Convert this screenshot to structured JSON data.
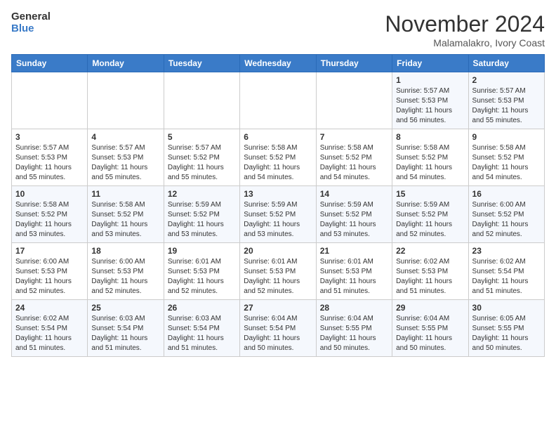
{
  "logo": {
    "line1": "General",
    "line2": "Blue"
  },
  "title": "November 2024",
  "location": "Malamalakro, Ivory Coast",
  "weekdays": [
    "Sunday",
    "Monday",
    "Tuesday",
    "Wednesday",
    "Thursday",
    "Friday",
    "Saturday"
  ],
  "weeks": [
    [
      {
        "day": "",
        "info": ""
      },
      {
        "day": "",
        "info": ""
      },
      {
        "day": "",
        "info": ""
      },
      {
        "day": "",
        "info": ""
      },
      {
        "day": "",
        "info": ""
      },
      {
        "day": "1",
        "info": "Sunrise: 5:57 AM\nSunset: 5:53 PM\nDaylight: 11 hours\nand 56 minutes."
      },
      {
        "day": "2",
        "info": "Sunrise: 5:57 AM\nSunset: 5:53 PM\nDaylight: 11 hours\nand 55 minutes."
      }
    ],
    [
      {
        "day": "3",
        "info": "Sunrise: 5:57 AM\nSunset: 5:53 PM\nDaylight: 11 hours\nand 55 minutes."
      },
      {
        "day": "4",
        "info": "Sunrise: 5:57 AM\nSunset: 5:53 PM\nDaylight: 11 hours\nand 55 minutes."
      },
      {
        "day": "5",
        "info": "Sunrise: 5:57 AM\nSunset: 5:52 PM\nDaylight: 11 hours\nand 55 minutes."
      },
      {
        "day": "6",
        "info": "Sunrise: 5:58 AM\nSunset: 5:52 PM\nDaylight: 11 hours\nand 54 minutes."
      },
      {
        "day": "7",
        "info": "Sunrise: 5:58 AM\nSunset: 5:52 PM\nDaylight: 11 hours\nand 54 minutes."
      },
      {
        "day": "8",
        "info": "Sunrise: 5:58 AM\nSunset: 5:52 PM\nDaylight: 11 hours\nand 54 minutes."
      },
      {
        "day": "9",
        "info": "Sunrise: 5:58 AM\nSunset: 5:52 PM\nDaylight: 11 hours\nand 54 minutes."
      }
    ],
    [
      {
        "day": "10",
        "info": "Sunrise: 5:58 AM\nSunset: 5:52 PM\nDaylight: 11 hours\nand 53 minutes."
      },
      {
        "day": "11",
        "info": "Sunrise: 5:58 AM\nSunset: 5:52 PM\nDaylight: 11 hours\nand 53 minutes."
      },
      {
        "day": "12",
        "info": "Sunrise: 5:59 AM\nSunset: 5:52 PM\nDaylight: 11 hours\nand 53 minutes."
      },
      {
        "day": "13",
        "info": "Sunrise: 5:59 AM\nSunset: 5:52 PM\nDaylight: 11 hours\nand 53 minutes."
      },
      {
        "day": "14",
        "info": "Sunrise: 5:59 AM\nSunset: 5:52 PM\nDaylight: 11 hours\nand 53 minutes."
      },
      {
        "day": "15",
        "info": "Sunrise: 5:59 AM\nSunset: 5:52 PM\nDaylight: 11 hours\nand 52 minutes."
      },
      {
        "day": "16",
        "info": "Sunrise: 6:00 AM\nSunset: 5:52 PM\nDaylight: 11 hours\nand 52 minutes."
      }
    ],
    [
      {
        "day": "17",
        "info": "Sunrise: 6:00 AM\nSunset: 5:53 PM\nDaylight: 11 hours\nand 52 minutes."
      },
      {
        "day": "18",
        "info": "Sunrise: 6:00 AM\nSunset: 5:53 PM\nDaylight: 11 hours\nand 52 minutes."
      },
      {
        "day": "19",
        "info": "Sunrise: 6:01 AM\nSunset: 5:53 PM\nDaylight: 11 hours\nand 52 minutes."
      },
      {
        "day": "20",
        "info": "Sunrise: 6:01 AM\nSunset: 5:53 PM\nDaylight: 11 hours\nand 52 minutes."
      },
      {
        "day": "21",
        "info": "Sunrise: 6:01 AM\nSunset: 5:53 PM\nDaylight: 11 hours\nand 51 minutes."
      },
      {
        "day": "22",
        "info": "Sunrise: 6:02 AM\nSunset: 5:53 PM\nDaylight: 11 hours\nand 51 minutes."
      },
      {
        "day": "23",
        "info": "Sunrise: 6:02 AM\nSunset: 5:54 PM\nDaylight: 11 hours\nand 51 minutes."
      }
    ],
    [
      {
        "day": "24",
        "info": "Sunrise: 6:02 AM\nSunset: 5:54 PM\nDaylight: 11 hours\nand 51 minutes."
      },
      {
        "day": "25",
        "info": "Sunrise: 6:03 AM\nSunset: 5:54 PM\nDaylight: 11 hours\nand 51 minutes."
      },
      {
        "day": "26",
        "info": "Sunrise: 6:03 AM\nSunset: 5:54 PM\nDaylight: 11 hours\nand 51 minutes."
      },
      {
        "day": "27",
        "info": "Sunrise: 6:04 AM\nSunset: 5:54 PM\nDaylight: 11 hours\nand 50 minutes."
      },
      {
        "day": "28",
        "info": "Sunrise: 6:04 AM\nSunset: 5:55 PM\nDaylight: 11 hours\nand 50 minutes."
      },
      {
        "day": "29",
        "info": "Sunrise: 6:04 AM\nSunset: 5:55 PM\nDaylight: 11 hours\nand 50 minutes."
      },
      {
        "day": "30",
        "info": "Sunrise: 6:05 AM\nSunset: 5:55 PM\nDaylight: 11 hours\nand 50 minutes."
      }
    ]
  ]
}
